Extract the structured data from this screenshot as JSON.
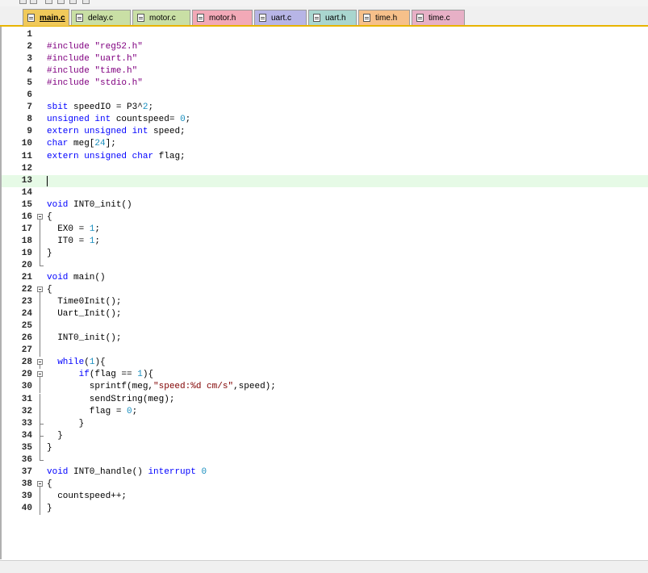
{
  "tabs": [
    {
      "label": "main.c",
      "color": "#f0c95a",
      "active": true
    },
    {
      "label": "delay.c",
      "color": "#c9dfa5",
      "active": false
    },
    {
      "label": "motor.c",
      "color": "#c9dfa5",
      "active": false
    },
    {
      "label": "motor.h",
      "color": "#f2a9b7",
      "active": false
    },
    {
      "label": "uart.c",
      "color": "#b7b5e6",
      "active": false
    },
    {
      "label": "uart.h",
      "color": "#a9d6cf",
      "active": false
    },
    {
      "label": "time.h",
      "color": "#f6c08a",
      "active": false
    },
    {
      "label": "time.c",
      "color": "#e7b0c6",
      "active": false
    }
  ],
  "editor": {
    "current_line": 13,
    "lines": [
      {
        "n": "1",
        "text": ""
      },
      {
        "n": "2",
        "text": "#include \"reg52.h\""
      },
      {
        "n": "3",
        "text": "#include \"uart.h\""
      },
      {
        "n": "4",
        "text": "#include \"time.h\""
      },
      {
        "n": "5",
        "text": "#include \"stdio.h\""
      },
      {
        "n": "6",
        "text": ""
      },
      {
        "n": "7",
        "text": "sbit speedIO = P3^2;"
      },
      {
        "n": "8",
        "text": "unsigned int countspeed= 0;"
      },
      {
        "n": "9",
        "text": "extern unsigned int speed;"
      },
      {
        "n": "10",
        "text": "char meg[24];"
      },
      {
        "n": "11",
        "text": "extern unsigned char flag;"
      },
      {
        "n": "12",
        "text": ""
      },
      {
        "n": "13",
        "text": ""
      },
      {
        "n": "14",
        "text": ""
      },
      {
        "n": "15",
        "text": "void INT0_init()"
      },
      {
        "n": "16",
        "text": "{"
      },
      {
        "n": "17",
        "text": "  EX0 = 1;"
      },
      {
        "n": "18",
        "text": "  IT0 = 1;"
      },
      {
        "n": "19",
        "text": "}"
      },
      {
        "n": "20",
        "text": ""
      },
      {
        "n": "21",
        "text": "void main()"
      },
      {
        "n": "22",
        "text": "{"
      },
      {
        "n": "23",
        "text": "  Time0Init();"
      },
      {
        "n": "24",
        "text": "  Uart_Init();"
      },
      {
        "n": "25",
        "text": ""
      },
      {
        "n": "26",
        "text": "  INT0_init();"
      },
      {
        "n": "27",
        "text": ""
      },
      {
        "n": "28",
        "text": "  while(1){"
      },
      {
        "n": "29",
        "text": "      if(flag == 1){"
      },
      {
        "n": "30",
        "text": "        sprintf(meg,\"speed:%d cm/s\",speed);"
      },
      {
        "n": "31",
        "text": "        sendString(meg);"
      },
      {
        "n": "32",
        "text": "        flag = 0;"
      },
      {
        "n": "33",
        "text": "      }"
      },
      {
        "n": "34",
        "text": "  }"
      },
      {
        "n": "35",
        "text": "}"
      },
      {
        "n": "36",
        "text": ""
      },
      {
        "n": "37",
        "text": "void INT0_handle() interrupt 0"
      },
      {
        "n": "38",
        "text": "{"
      },
      {
        "n": "39",
        "text": "  countspeed++;"
      },
      {
        "n": "40",
        "text": "}"
      }
    ]
  }
}
